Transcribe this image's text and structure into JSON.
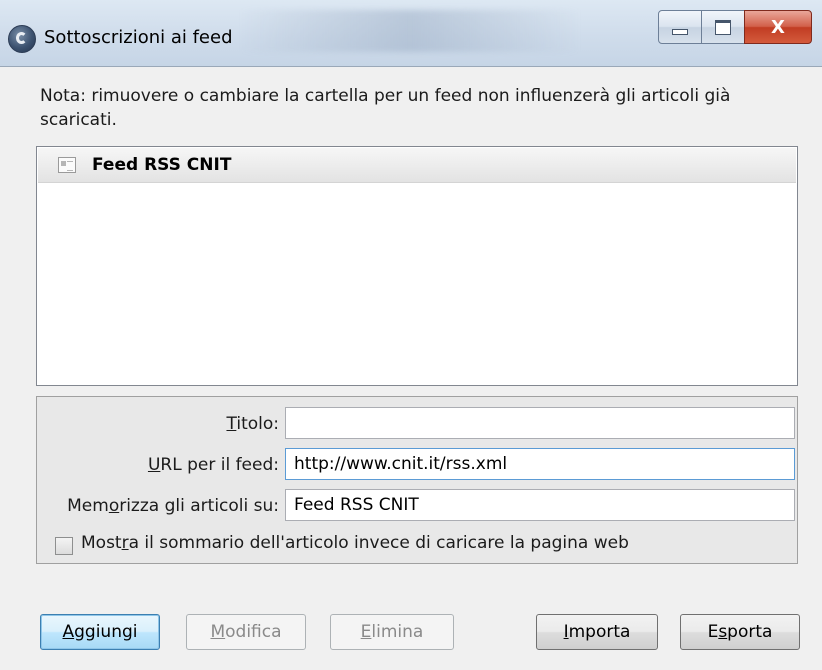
{
  "window": {
    "title": "Sottoscrizioni ai feed",
    "minimize_glyph": "",
    "maximize_glyph": "",
    "close_glyph": "X"
  },
  "note": "Nota: rimuovere o cambiare la cartella per un feed non influenzerà gli articoli già scaricati.",
  "feeds": [
    {
      "label": "Feed RSS CNIT",
      "icon": "feed-folder-icon"
    }
  ],
  "form": {
    "title_label_u": "T",
    "title_label_rest": "itolo:",
    "title_value": "",
    "url_label_u": "U",
    "url_label_rest": "RL per il feed:",
    "url_value": "http://www.cnit.it/rss.xml",
    "store_label_pre": "Mem",
    "store_label_u": "o",
    "store_label_rest": "rizza gli articoli su:",
    "store_value": "Feed RSS CNIT",
    "summary_pre": "Most",
    "summary_u": "r",
    "summary_rest": "a il sommario dell'articolo invece di caricare la pagina web",
    "summary_checked": false
  },
  "buttons": {
    "add_u": "A",
    "add_rest": "ggiungi",
    "edit_u": "M",
    "edit_rest": "odifica",
    "delete_u": "E",
    "delete_rest": "limina",
    "import_u": "I",
    "import_rest": "mporta",
    "export_pre": "E",
    "export_u": "s",
    "export_rest": "porta"
  }
}
